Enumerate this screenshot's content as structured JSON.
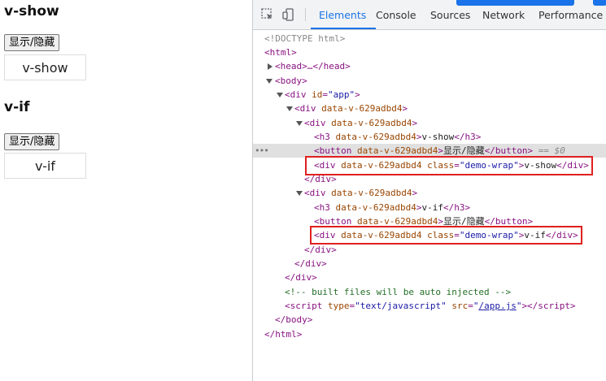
{
  "page": {
    "section1": {
      "title": "v-show",
      "button": "显示/隐藏",
      "demo": "v-show"
    },
    "section2": {
      "title": "v-if",
      "button": "显示/隐藏",
      "demo": "v-if"
    }
  },
  "devtools": {
    "tabs": [
      "Elements",
      "Console",
      "Sources",
      "Network",
      "Performance"
    ],
    "active_tab": "Elements",
    "selected_suffix": "== $0",
    "lines": {
      "doctype": "<!DOCTYPE html>",
      "html_open": "<html>",
      "head": "<head>…</head>",
      "body_open": "<body>",
      "div_app": {
        "tag": "div",
        "attr": "id",
        "val": "app"
      },
      "scope_attr": "data-v-629adbd4",
      "class_attr": "class",
      "class_val": "demo-wrap",
      "h3_text_1": "v-show",
      "h3_text_2": "v-if",
      "button_text": "显示/隐藏",
      "demo_text_1": "v-show",
      "demo_text_2": "v-if",
      "comment": "<!-- built files will be auto injected -->",
      "script": {
        "type_val": "text/javascript",
        "src_val": "/app.js"
      },
      "body_close": "</body>",
      "html_close": "</html>"
    }
  },
  "colors": {
    "accent": "#1a73e8",
    "highlight_box": "#e02020",
    "tag": "#881280",
    "attr": "#994500",
    "value": "#1a1aa6",
    "comment": "#236e25"
  }
}
